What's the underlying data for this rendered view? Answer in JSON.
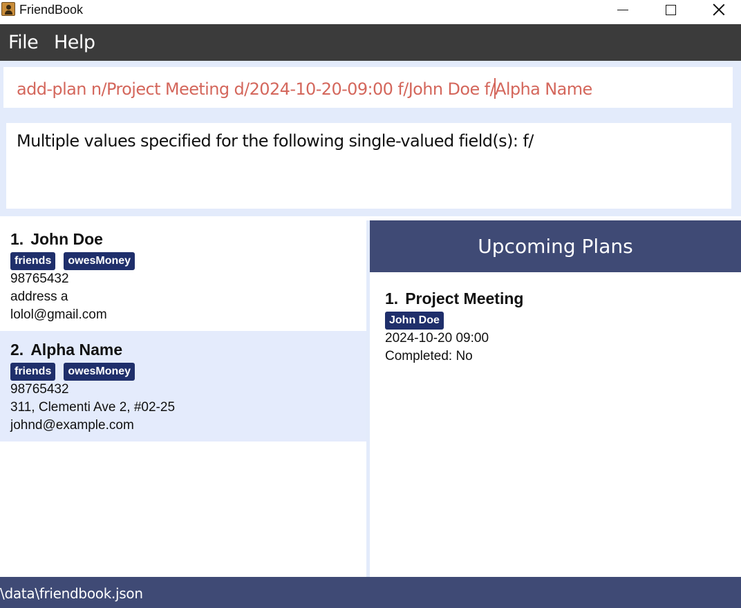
{
  "window": {
    "title": "FriendBook",
    "icon": "app-icon"
  },
  "menu": {
    "file": "File",
    "help": "Help"
  },
  "command": {
    "before_caret": "add-plan n/Project Meeting d/2024-10-20-09:00 f/John Doe f/",
    "after_caret": "Alpha Name"
  },
  "result": {
    "text": "Multiple values specified for the following single-valued field(s): f/"
  },
  "persons": [
    {
      "index": "1.",
      "name": "John Doe",
      "tags": [
        "friends",
        "owesMoney"
      ],
      "phone": "98765432",
      "address": "address a",
      "email": "lolol@gmail.com"
    },
    {
      "index": "2.",
      "name": "Alpha Name",
      "tags": [
        "friends",
        "owesMoney"
      ],
      "phone": "98765432",
      "address": "311, Clementi Ave 2, #02-25",
      "email": "johnd@example.com"
    }
  ],
  "plans": {
    "header": "Upcoming Plans",
    "items": [
      {
        "index": "1.",
        "title": "Project Meeting",
        "friend": "John Doe",
        "datetime": "2024-10-20 09:00",
        "completed": "Completed: No"
      }
    ]
  },
  "status": {
    "path": "\\data\\friendbook.json"
  },
  "colors": {
    "menubar": "#3b3b3b",
    "accent": "#3f4a75",
    "tag": "#1f2f6b",
    "command_text": "#d4675c",
    "panel_bg": "#e3ebfb"
  }
}
